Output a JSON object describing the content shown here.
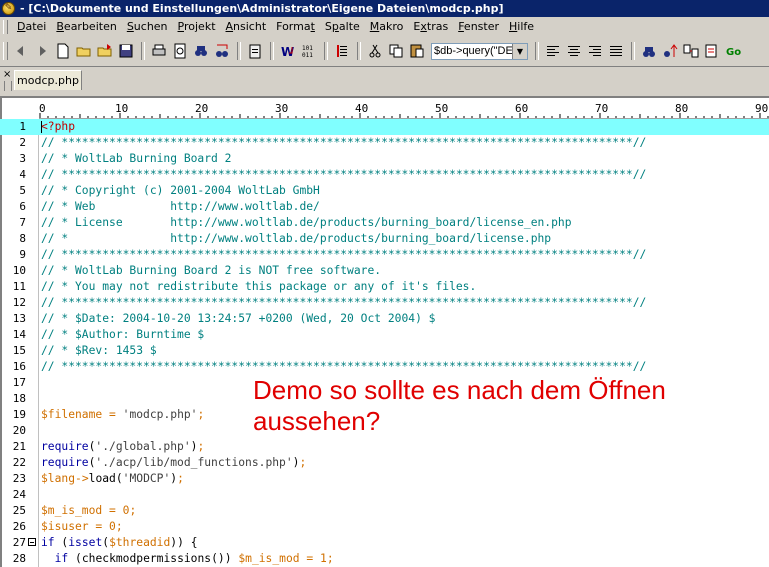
{
  "window": {
    "title": "- [C:\\Dokumente und Einstellungen\\Administrator\\Eigene Dateien\\modcp.php]"
  },
  "menu": [
    {
      "pre": "",
      "u": "D",
      "post": "atei"
    },
    {
      "pre": "",
      "u": "B",
      "post": "earbeiten"
    },
    {
      "pre": "",
      "u": "S",
      "post": "uchen"
    },
    {
      "pre": "",
      "u": "P",
      "post": "rojekt"
    },
    {
      "pre": "",
      "u": "A",
      "post": "nsicht"
    },
    {
      "pre": "Forma",
      "u": "t",
      "post": ""
    },
    {
      "pre": "S",
      "u": "p",
      "post": "alte"
    },
    {
      "pre": "",
      "u": "M",
      "post": "akro"
    },
    {
      "pre": "E",
      "u": "x",
      "post": "tras"
    },
    {
      "pre": "",
      "u": "F",
      "post": "enster"
    },
    {
      "pre": "",
      "u": "H",
      "post": "ilfe"
    }
  ],
  "toolbar": {
    "combo_value": "$db->query(\"DE"
  },
  "tabs": [
    {
      "label": "modcp.php"
    }
  ],
  "ruler": {
    "labels": [
      "0",
      "10",
      "20",
      "30",
      "40",
      "50",
      "60",
      "70",
      "80",
      "90"
    ]
  },
  "editor": {
    "line_numbers": [
      "1",
      "2",
      "3",
      "4",
      "5",
      "6",
      "7",
      "8",
      "9",
      "10",
      "11",
      "12",
      "13",
      "14",
      "15",
      "16",
      "17",
      "18",
      "19",
      "20",
      "21",
      "22",
      "23",
      "24",
      "25",
      "26",
      "27",
      "28"
    ],
    "lines": [
      "<?php",
      "// ************************************************************************************//",
      "// * WoltLab Burning Board 2",
      "// ************************************************************************************//",
      "// * Copyright (c) 2001-2004 WoltLab GmbH",
      "// * Web           http://www.woltlab.de/",
      "// * License       http://www.woltlab.de/products/burning_board/license_en.php",
      "// *               http://www.woltlab.de/products/burning_board/license.php",
      "// ************************************************************************************//",
      "// * WoltLab Burning Board 2 is NOT free software.",
      "// * You may not redistribute this package or any of it's files.",
      "// ************************************************************************************//",
      "// * $Date: 2004-10-20 13:24:57 +0200 (Wed, 20 Oct 2004) $",
      "// * $Author: Burntime $",
      "// * $Rev: 1453 $",
      "// ************************************************************************************//",
      "",
      "",
      "$filename = 'modcp.php';",
      "",
      "require('./global.php');",
      "require('./acp/lib/mod_functions.php');",
      "$lang->load('MODCP');",
      "",
      "$m_is_mod = 0;",
      "$isuser = 0;",
      "if (isset($threadid)) {",
      "  if (checkmodpermissions()) $m_is_mod = 1;"
    ]
  },
  "overlay": {
    "line1": "Demo so sollte es nach dem Öffnen",
    "line2": "aussehen?"
  }
}
